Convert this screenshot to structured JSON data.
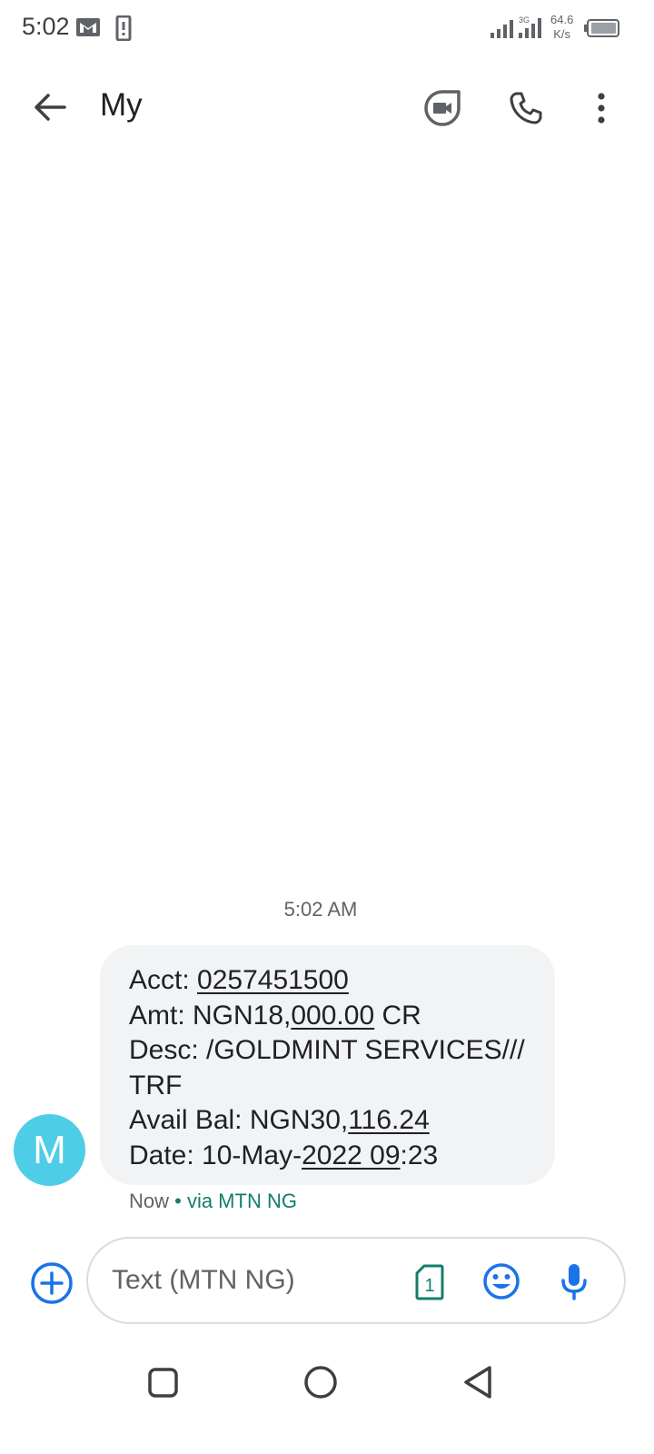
{
  "status_bar": {
    "time": "5:02",
    "net_speed_value": "64.6",
    "net_speed_unit": "K/s",
    "icons": [
      "gmail-icon",
      "sim-alert-icon",
      "signal-icon",
      "battery-icon"
    ]
  },
  "app_bar": {
    "title": "My",
    "icons": [
      "back-arrow-icon",
      "video-call-icon",
      "phone-icon",
      "more-vert-icon"
    ]
  },
  "conversation": {
    "timestamp": "5:02 AM",
    "avatar_letter": "M",
    "avatar_color": "#4ecde6",
    "message": {
      "lines": [
        {
          "prefix": "Acct: ",
          "link": "0257451500",
          "suffix": ""
        },
        {
          "prefix": "Amt: NGN18,",
          "link": "000.00",
          "suffix": " CR"
        },
        {
          "prefix": "Desc: /GOLDMINT SERVICES///",
          "link": "",
          "suffix": ""
        },
        {
          "prefix": "TRF",
          "link": "",
          "suffix": ""
        },
        {
          "prefix": "Avail Bal: NGN30,",
          "link": "116.24",
          "suffix": ""
        },
        {
          "prefix": "Date: 10-May-",
          "link": "2022 09",
          "suffix": ":23"
        }
      ]
    },
    "meta_time": "Now",
    "meta_via": " • via MTN NG"
  },
  "compose": {
    "placeholder": "Text (MTN NG)",
    "sim_slot": "1",
    "accent_color": "#1a73e8"
  },
  "nav_bar": {
    "icons": [
      "recents-square-icon",
      "home-circle-icon",
      "back-triangle-icon"
    ]
  }
}
